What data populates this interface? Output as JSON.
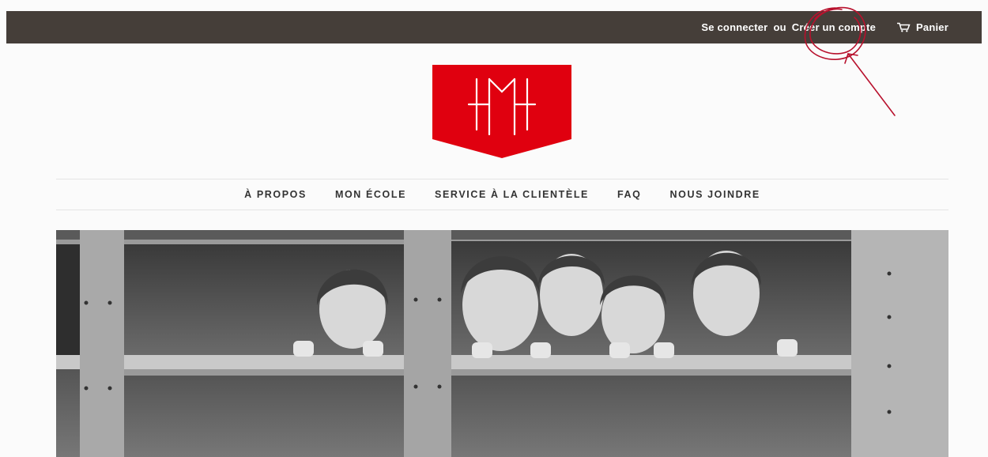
{
  "topbar": {
    "login_label": "Se connecter",
    "or_label": "ou",
    "register_label": "Créer un compte",
    "cart_label": "Panier",
    "cart_icon": "cart-icon"
  },
  "logo": {
    "text": "HFM",
    "color": "#e0000f"
  },
  "nav": {
    "items": [
      {
        "label": "À PROPOS"
      },
      {
        "label": "MON ÉCOLE"
      },
      {
        "label": "SERVICE À LA CLIENTÈLE"
      },
      {
        "label": "FAQ"
      },
      {
        "label": "NOUS JOINDRE"
      }
    ]
  },
  "hero": {
    "alt": "Photo en noir et blanc d'enfants regardant par les fenêtres d'un autobus scolaire"
  },
  "colors": {
    "topbar": "#453e39",
    "accent": "#e0000f",
    "annotation": "#b8112d"
  }
}
